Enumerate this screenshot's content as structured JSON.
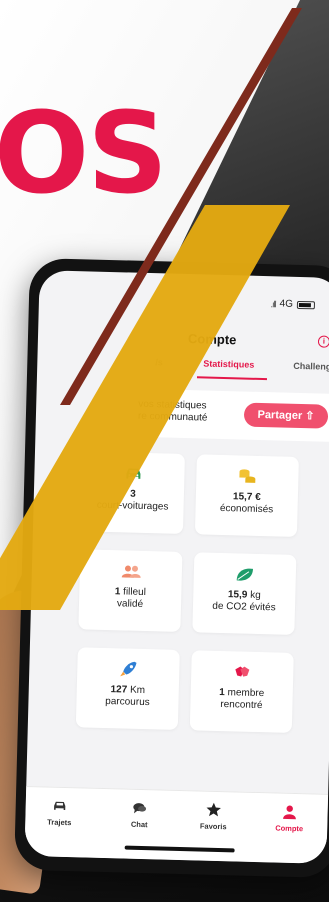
{
  "brand": {
    "logo_fragment": "OS",
    "logo_color": "#e4174a"
  },
  "status_bar": {
    "signal": ".ıll",
    "network": "4G"
  },
  "header": {
    "title": "Compte",
    "info_icon": "info-icon"
  },
  "tabs": [
    {
      "label": "/s",
      "active": false
    },
    {
      "label": "Statistiques",
      "active": true
    },
    {
      "label": "Challenges",
      "active": false
    }
  ],
  "share": {
    "text_line1": "vos statistiques",
    "text_line2": "re communauté",
    "button_label": "Partager",
    "button_icon": "upload-icon"
  },
  "stats": [
    {
      "value": "3",
      "unit": "",
      "label": "court-voiturages",
      "icon": "car-icon",
      "color": "#2f9a4f"
    },
    {
      "value": "15,7",
      "unit": "€",
      "label": "économisés",
      "icon": "coins-icon",
      "color": "#f2c233"
    },
    {
      "value": "1",
      "unit": "filleul",
      "label": "validé",
      "icon": "people-icon",
      "color": "#f08a6b"
    },
    {
      "value": "15,9",
      "unit": "kg",
      "label": "de CO2 évités",
      "icon": "leaf-icon",
      "color": "#1f9d6b"
    },
    {
      "value": "127",
      "unit": "Km",
      "label": "parcourus",
      "icon": "rocket-icon",
      "color": "#2f7fd4"
    },
    {
      "value": "1",
      "unit": "membre",
      "label": "rencontré",
      "icon": "handshake-icon",
      "color": "#e4174a"
    }
  ],
  "bottom_nav": [
    {
      "label": "Trajets",
      "icon": "car-icon",
      "active": false
    },
    {
      "label": "Chat",
      "icon": "chat-icon",
      "active": false
    },
    {
      "label": "Favoris",
      "icon": "star-icon",
      "active": false
    },
    {
      "label": "Compte",
      "icon": "user-icon",
      "active": true
    }
  ],
  "colors": {
    "accent": "#e4174a",
    "share_button": "#f0506e",
    "stripe_red": "#7e2a1c",
    "stripe_yellow": "#e3a912"
  }
}
